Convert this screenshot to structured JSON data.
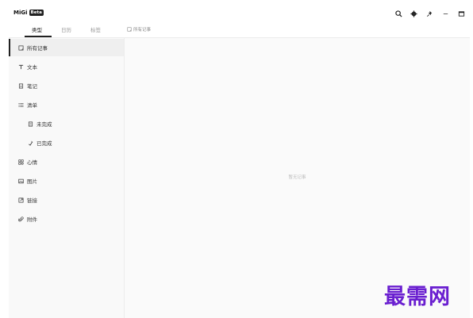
{
  "app": {
    "name": "MiGi",
    "badge": "Beta"
  },
  "header_icons": [
    "search-icon",
    "gear-icon",
    "pin-icon",
    "minimize-icon",
    "maximize-icon"
  ],
  "tabs": [
    {
      "label": "类型",
      "active": true
    },
    {
      "label": "日历",
      "active": false
    },
    {
      "label": "标签",
      "active": false
    }
  ],
  "breadcrumb": {
    "icon": "note-icon",
    "label": "所有记事"
  },
  "sidebar": {
    "items": [
      {
        "label": "所有记事",
        "icon": "note-icon",
        "selected": true
      },
      {
        "label": "文本",
        "icon": "text-icon",
        "selected": false
      },
      {
        "label": "笔记",
        "icon": "notebook-icon",
        "selected": false
      },
      {
        "label": "清单",
        "icon": "list-icon",
        "selected": false
      },
      {
        "label": "未完成",
        "icon": "incomplete-icon",
        "selected": false
      },
      {
        "label": "已完成",
        "icon": "complete-icon",
        "selected": false
      },
      {
        "label": "心情",
        "icon": "mood-icon",
        "selected": false
      },
      {
        "label": "图片",
        "icon": "image-icon",
        "selected": false
      },
      {
        "label": "链接",
        "icon": "link-icon",
        "selected": false
      },
      {
        "label": "附件",
        "icon": "attachment-icon",
        "selected": false
      }
    ]
  },
  "main": {
    "empty_text": "暂无记事"
  },
  "watermark": "最需网",
  "colors": {
    "accent": "#222222",
    "watermark": "#6a1fd0"
  }
}
